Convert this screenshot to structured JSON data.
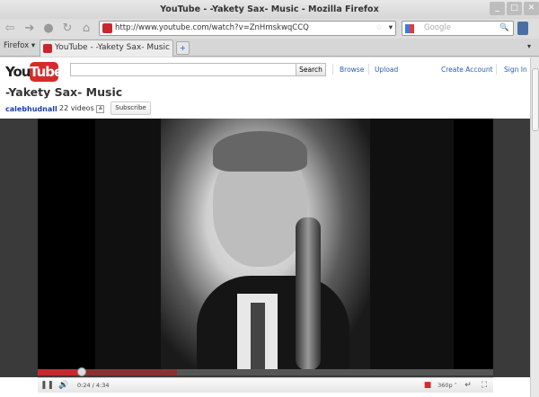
{
  "window": {
    "title": "YouTube - -Yakety Sax- Music - Mozilla Firefox"
  },
  "nav": {
    "url": "http://www.youtube.com/watch?v=ZnHmskwqCCQ",
    "search_placeholder": "Google",
    "firefox_menu": "Firefox ▾"
  },
  "tabs": [
    {
      "label": "YouTube - -Yakety Sax- Music"
    }
  ],
  "youtube": {
    "logo": "YouTube",
    "search_button": "Search",
    "browse": "Browse",
    "upload": "Upload",
    "create_account": "Create Account",
    "sign_in": "Sign In"
  },
  "video": {
    "title": "-Yakety Sax- Music",
    "channel": "calebhudnall",
    "video_count": "22 videos",
    "subscribe": "Subscribe",
    "time": "0:24 / 4:34",
    "quality": "360p",
    "played_percent": 9.7,
    "loaded_percent": 30.5
  },
  "colors": {
    "accent": "#c8282d",
    "link": "#2a5db0"
  }
}
